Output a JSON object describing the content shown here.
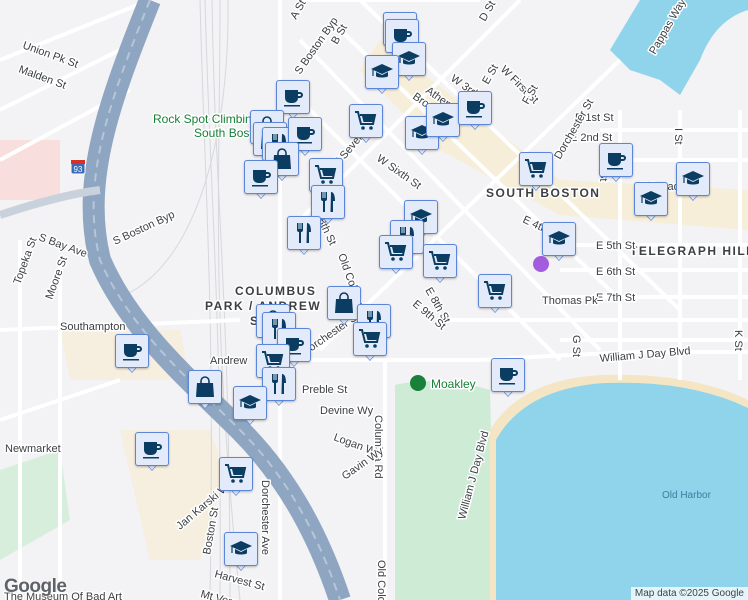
{
  "map": {
    "areas": [
      "SOUTH BOSTON",
      "TELEGRAPH HILL",
      "COLUMBUS",
      "PARK / ANDREW",
      "SQ"
    ],
    "pois": [
      "Rock Spot Climbing",
      "South Boston",
      "Moakley",
      "The Museum Of Bad Art",
      "Newmarket",
      "Old Harbor"
    ],
    "streets": [
      "A St",
      "S Boston Byp",
      "B St",
      "Union Pk St",
      "Malden St",
      "D St",
      "W First St",
      "Pappas Way",
      "E 1st St",
      "E 2nd St",
      "Dorchester St",
      "W 3rd",
      "Athens",
      "Broadway",
      "W Sixth St",
      "W Seventh St",
      "E St",
      "F St",
      "H St",
      "I St",
      "K St",
      "S Boston Byp",
      "S Bay Ave",
      "Topeka St",
      "Moore St",
      "8th St",
      "Old Colony Ave",
      "E 4th St",
      "E 5th St",
      "E 6th St",
      "E 7th St",
      "E 8th St",
      "Thomas Pk",
      "E 9th St",
      "G St",
      "Southampton",
      "Dorchester St",
      "Andrew",
      "Preble St",
      "Columbia Rd",
      "William J Day Blvd",
      "Devine Wy",
      "Logan Wy",
      "Gavin Wy",
      "Old Colony",
      "William J Day Blvd",
      "Jan Karski Way",
      "Boston St",
      "Dorchester Ave",
      "Harvest St",
      "Mt Vernon",
      "E Broadway"
    ],
    "highway_shield": "93"
  },
  "markers": [
    "coffee-icon",
    "coffee-icon",
    "graduation-cap-icon",
    "graduation-cap-icon",
    "coffee-icon",
    "shopping-bag-icon",
    "shopping-bag-icon",
    "cart-icon",
    "graduation-cap-icon",
    "graduation-cap-icon",
    "coffee-icon",
    "fork-knife-icon",
    "coffee-icon",
    "shopping-bag-icon",
    "coffee-icon",
    "cart-icon",
    "fork-knife-icon",
    "fork-knife-icon",
    "graduation-cap-icon",
    "fork-knife-icon",
    "cart-icon",
    "cart-icon",
    "cart-icon",
    "coffee-icon",
    "graduation-cap-icon",
    "graduation-cap-icon",
    "graduation-cap-icon",
    "cart-icon",
    "shopping-bag-icon",
    "fork-knife-icon",
    "cart-icon",
    "shopping-bag-icon",
    "fork-knife-icon",
    "coffee-icon",
    "cart-icon",
    "fork-knife-icon",
    "coffee-icon",
    "shopping-bag-icon",
    "graduation-cap-icon",
    "coffee-icon",
    "coffee-icon",
    "cart-icon",
    "graduation-cap-icon"
  ],
  "colors": {
    "marker_icon": "#0b3d62",
    "marker_bg": "#e3ebfb",
    "marker_border": "#5b86d8",
    "water": "#8fd4ea",
    "park": "#cdebd5",
    "highway": "#8ea6c2"
  },
  "logo": "Google",
  "attribution": "Map data ©2025 Google"
}
